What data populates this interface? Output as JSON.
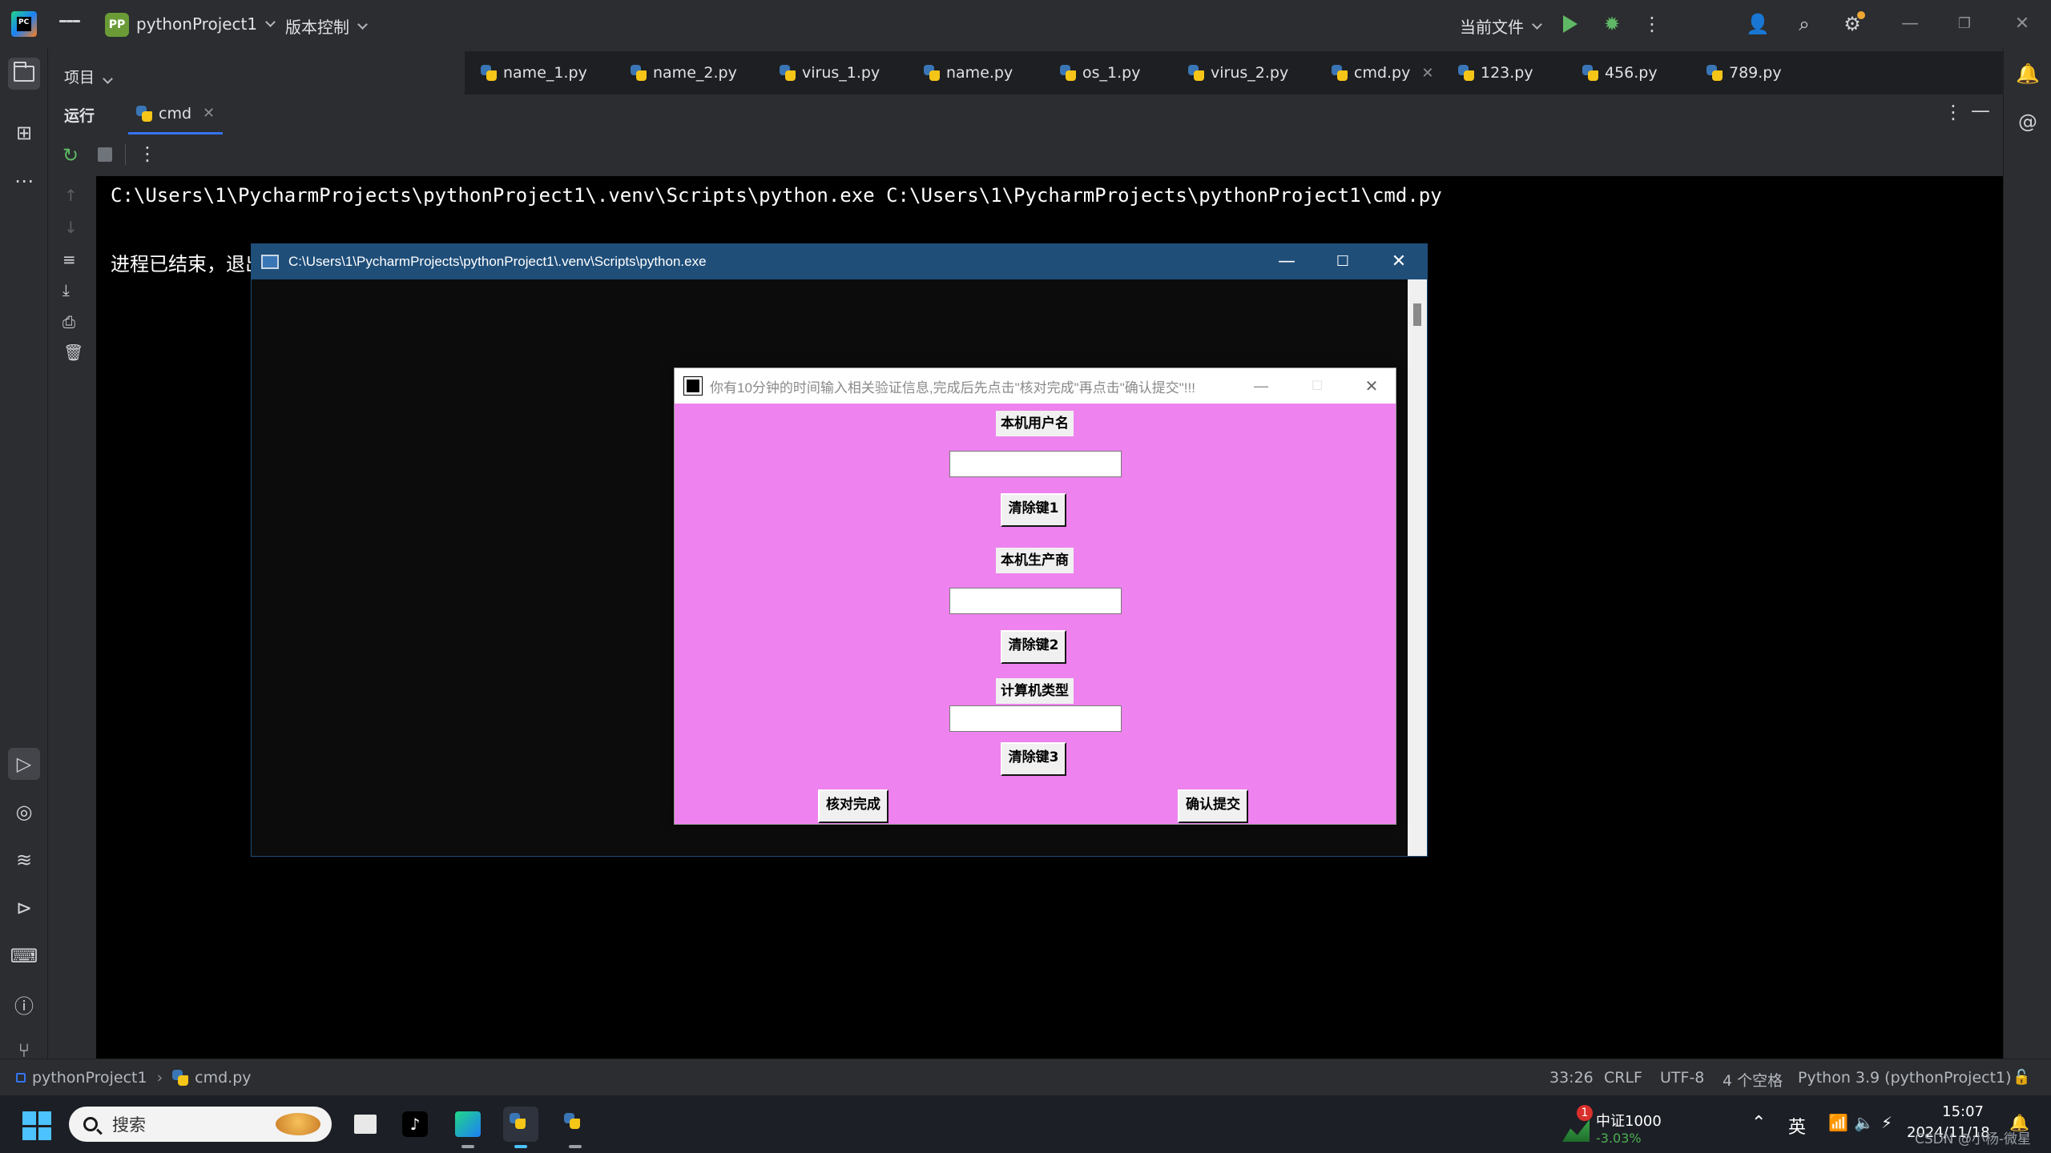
{
  "titlebar": {
    "logo_text": "PC",
    "project_badge": "PP",
    "project_name": "pythonProject1",
    "vcs_label": "版本控制",
    "current_file_label": "当前文件"
  },
  "project_panel": {
    "label": "项目"
  },
  "editor_tabs": [
    {
      "label": "name_1.py"
    },
    {
      "label": "name_2.py"
    },
    {
      "label": "virus_1.py"
    },
    {
      "label": "name.py"
    },
    {
      "label": "os_1.py"
    },
    {
      "label": "virus_2.py"
    },
    {
      "label": "cmd.py",
      "active": true
    },
    {
      "label": "123.py"
    },
    {
      "label": "456.py"
    },
    {
      "label": "789.py"
    }
  ],
  "run_window": {
    "title": "运行",
    "tab_label": "cmd",
    "command_line": "C:\\Users\\1\\PycharmProjects\\pythonProject1\\.venv\\Scripts\\python.exe C:\\Users\\1\\PycharmProjects\\pythonProject1\\cmd.py",
    "exit_message": "进程已结束，退出"
  },
  "console_window": {
    "title": "C:\\Users\\1\\PycharmProjects\\pythonProject1\\.venv\\Scripts\\python.exe"
  },
  "tk_dialog": {
    "title": "你有10分钟的时间输入相关验证信息,完成后先点击\"核对完成\"再点击\"确认提交\"!!!",
    "label_username": "本机用户名",
    "username_value": "",
    "clear_btn_1": "清除键1",
    "label_manufacturer": "本机生产商",
    "manufacturer_value": "",
    "clear_btn_2": "清除键2",
    "label_computer_type": "计算机类型",
    "computer_type_value": "",
    "clear_btn_3": "清除键3",
    "verify_btn": "核对完成",
    "submit_btn": "确认提交",
    "background_color": "#ee82ee"
  },
  "statusbar": {
    "breadcrumb_project": "pythonProject1",
    "breadcrumb_file": "cmd.py",
    "cursor_pos": "33:26",
    "line_ending": "CRLF",
    "encoding": "UTF-8",
    "indent": "4 个空格",
    "interpreter": "Python 3.9 (pythonProject1)"
  },
  "taskbar": {
    "search_placeholder": "搜索",
    "stock_name": "中证1000",
    "stock_change": "-3.03%",
    "stock_badge": "1",
    "ime": "英",
    "time": "15:07",
    "date": "2024/11/18",
    "watermark": "CSDN @小杨-微星"
  },
  "colors": {
    "ide_bg": "#2b2d30",
    "accent": "#3574f0",
    "console_title": "#1f4e79",
    "run_green": "#5fb865",
    "stock_down": "#4caf50"
  }
}
